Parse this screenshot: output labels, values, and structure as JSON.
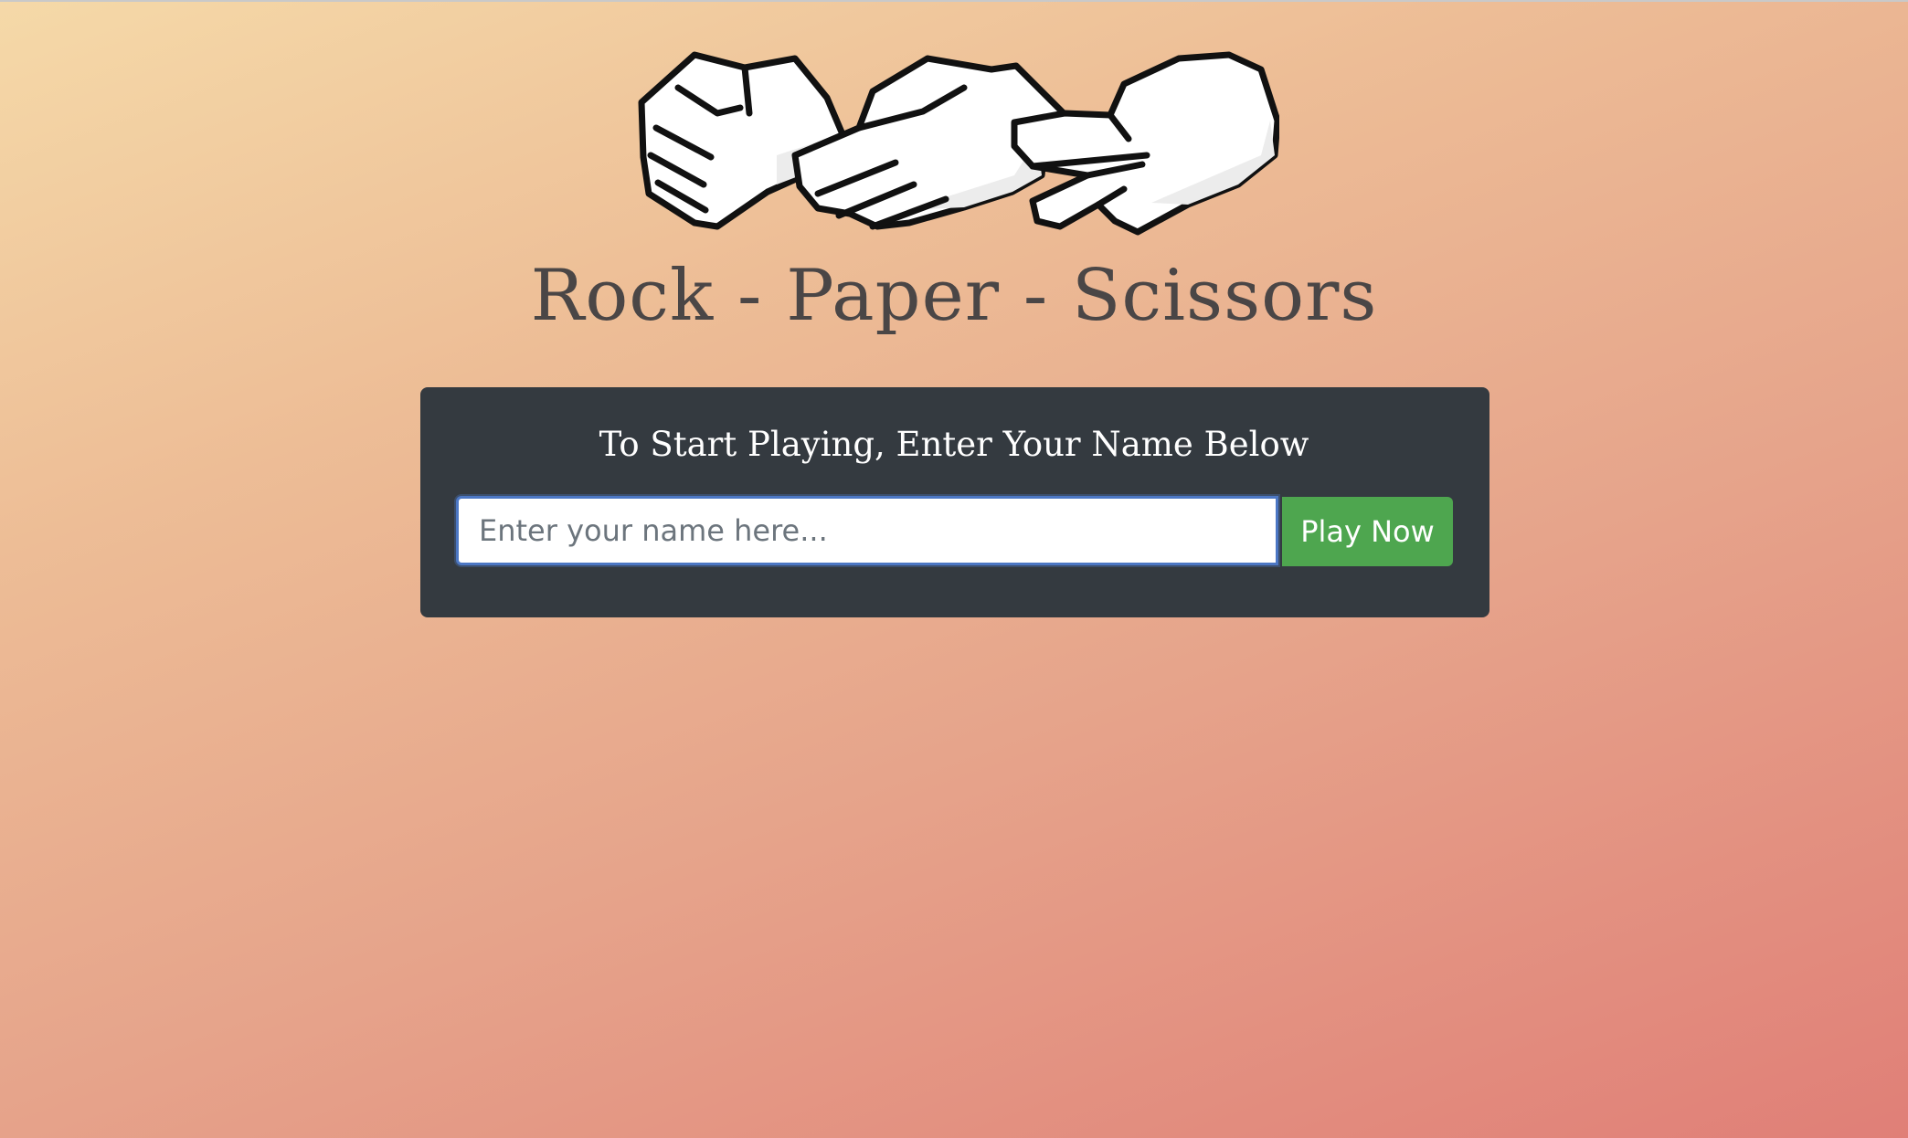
{
  "header": {
    "logo_icon": "rock-paper-scissors-hands-icon",
    "title": "Rock - Paper - Scissors"
  },
  "start_card": {
    "heading": "To Start Playing, Enter Your Name Below",
    "name_input": {
      "value": "",
      "placeholder": "Enter your name here..."
    },
    "play_button_label": "Play Now"
  },
  "colors": {
    "card_background": "#343a40",
    "play_button": "#4ea64f",
    "input_focus_border": "#4c77c4",
    "title_text": "#4a4646",
    "gradient_start": "#f5d9a8",
    "gradient_end": "#e07f77"
  }
}
